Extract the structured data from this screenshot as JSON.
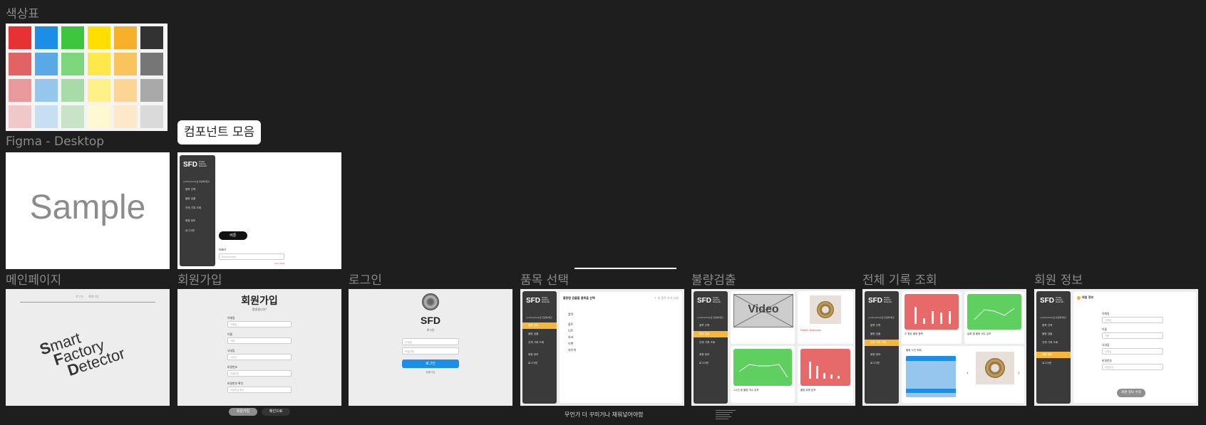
{
  "frames": {
    "palette": "색상표",
    "desktop": "Figma - Desktop",
    "components": "컴포넌트 모음",
    "main": "메인페이지",
    "signup": "회원가입",
    "login": "로그인",
    "product": "품목 선택",
    "defect": "불량검출",
    "records": "전체 기록 조회",
    "member": "회원 정보"
  },
  "palette_colors": [
    [
      "#e63232",
      "#1c8ee6",
      "#3dc63d",
      "#ffde00",
      "#f6b02c",
      "#323232"
    ],
    [
      "#e06464",
      "#5aa9e6",
      "#7cd67c",
      "#ffe84a",
      "#f9c35e",
      "#767676"
    ],
    [
      "#e8999b",
      "#96c6ec",
      "#a8dba8",
      "#fff08a",
      "#fbd594",
      "#a9a9a9"
    ],
    [
      "#f0c8ca",
      "#c6dff3",
      "#c8e3c8",
      "#fff9d2",
      "#fde8c9",
      "#dadada"
    ]
  ],
  "sample_text": "Sample",
  "sidebar": {
    "logo": "SFD",
    "logo_sub": "Smart Factory Detector",
    "user": "{nickname}님 안녕하세요!",
    "items": [
      "품목 선택",
      "불량 검출",
      "전체 기록 조회",
      "회원 정보",
      "로그아웃"
    ]
  },
  "components": {
    "button_label": "버튼",
    "input_label": "label",
    "input_placeholder": "Placeholder",
    "error_text": "error text"
  },
  "main_page": {
    "nav": [
      "로그인",
      "회원가입"
    ],
    "logo_lines": [
      [
        "S",
        "mart"
      ],
      [
        "F",
        "actory"
      ],
      [
        "D",
        "etector"
      ]
    ]
  },
  "signup": {
    "title": "회원가입",
    "subtitle": "환영합니다!",
    "fields": [
      "이메일",
      "이름",
      "닉네임",
      "비밀번호",
      "비밀번호 확인"
    ],
    "submit": "회원가입",
    "cancel": "메인으로"
  },
  "login": {
    "title": "SFD",
    "subtitle": "로그인",
    "email_ph": "이메일",
    "pw_ph": "비밀번호",
    "submit": "로그인",
    "link": "회원가입"
  },
  "product": {
    "heading": "불량탐 검출할 품목을 선택",
    "add": "+ 새 품목 추가 요청",
    "list_header": "품목",
    "items": [
      "볼트",
      "너트",
      "와셔",
      "리벳",
      "지우개"
    ],
    "note": "무언가 더 꾸미거나 채워넣어야함"
  },
  "defect": {
    "video": "Video",
    "status": "Defect Detected",
    "chart_caption_1": "1시간 동 불량 개수 분포",
    "chart_caption_2": "불량 유형 분포"
  },
  "records": {
    "caption_1": "주 평균 불량 품목",
    "caption_2": "날짜 별 불량 개수 분포",
    "caption_3": "불량 사진 조회"
  },
  "member": {
    "heading": "회원 정보",
    "fields": [
      "이메일",
      "이름",
      "닉네임",
      "비밀번호"
    ],
    "submit": "회원 정보 수정"
  }
}
